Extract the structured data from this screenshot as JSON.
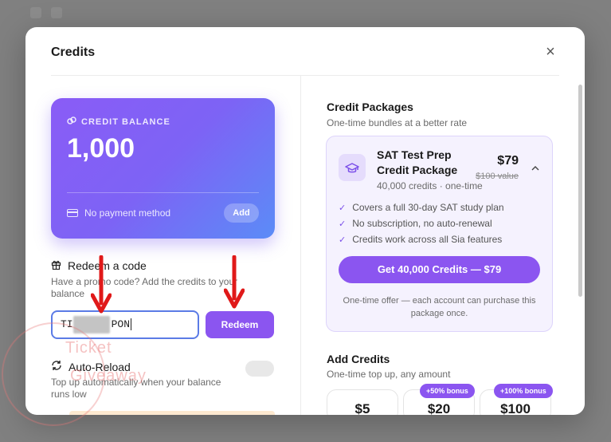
{
  "modal": {
    "title": "Credits"
  },
  "balance": {
    "label": "CREDIT BALANCE",
    "amount": "1,000",
    "payment": "No payment method",
    "add_label": "Add"
  },
  "redeem": {
    "title": "Redeem a code",
    "description": "Have a promo code? Add the credits to your balance",
    "code_prefix": "TI",
    "code_suffix": "PON",
    "button": "Redeem"
  },
  "auto_reload": {
    "title": "Auto-Reload",
    "description": "Top up automatically when your balance runs low",
    "enabled": false
  },
  "watermark": {
    "line1": "Ticket",
    "line2": "Giveaway"
  },
  "packages": {
    "title": "Credit Packages",
    "subtitle": "One-time bundles at a better rate",
    "item": {
      "name": "SAT Test Prep Credit Package",
      "meta": "40,000 credits · one-time",
      "price": "$79",
      "old_price": "$100 value",
      "features": [
        "Covers a full 30-day SAT study plan",
        "No subscription, no auto-renewal",
        "Credits work across all Sia features"
      ],
      "button": "Get 40,000 Credits — $79",
      "note": "One-time offer — each account can purchase this package once."
    }
  },
  "add_credits": {
    "title": "Add Credits",
    "subtitle": "One-time top up, any amount",
    "options": [
      {
        "amount": "$5",
        "bonus": ""
      },
      {
        "amount": "$20",
        "bonus": "+50% bonus"
      },
      {
        "amount": "$100",
        "bonus": "+100% bonus"
      }
    ]
  },
  "colors": {
    "accent": "#8b55f0",
    "annotation_arrow": "#e01919"
  }
}
